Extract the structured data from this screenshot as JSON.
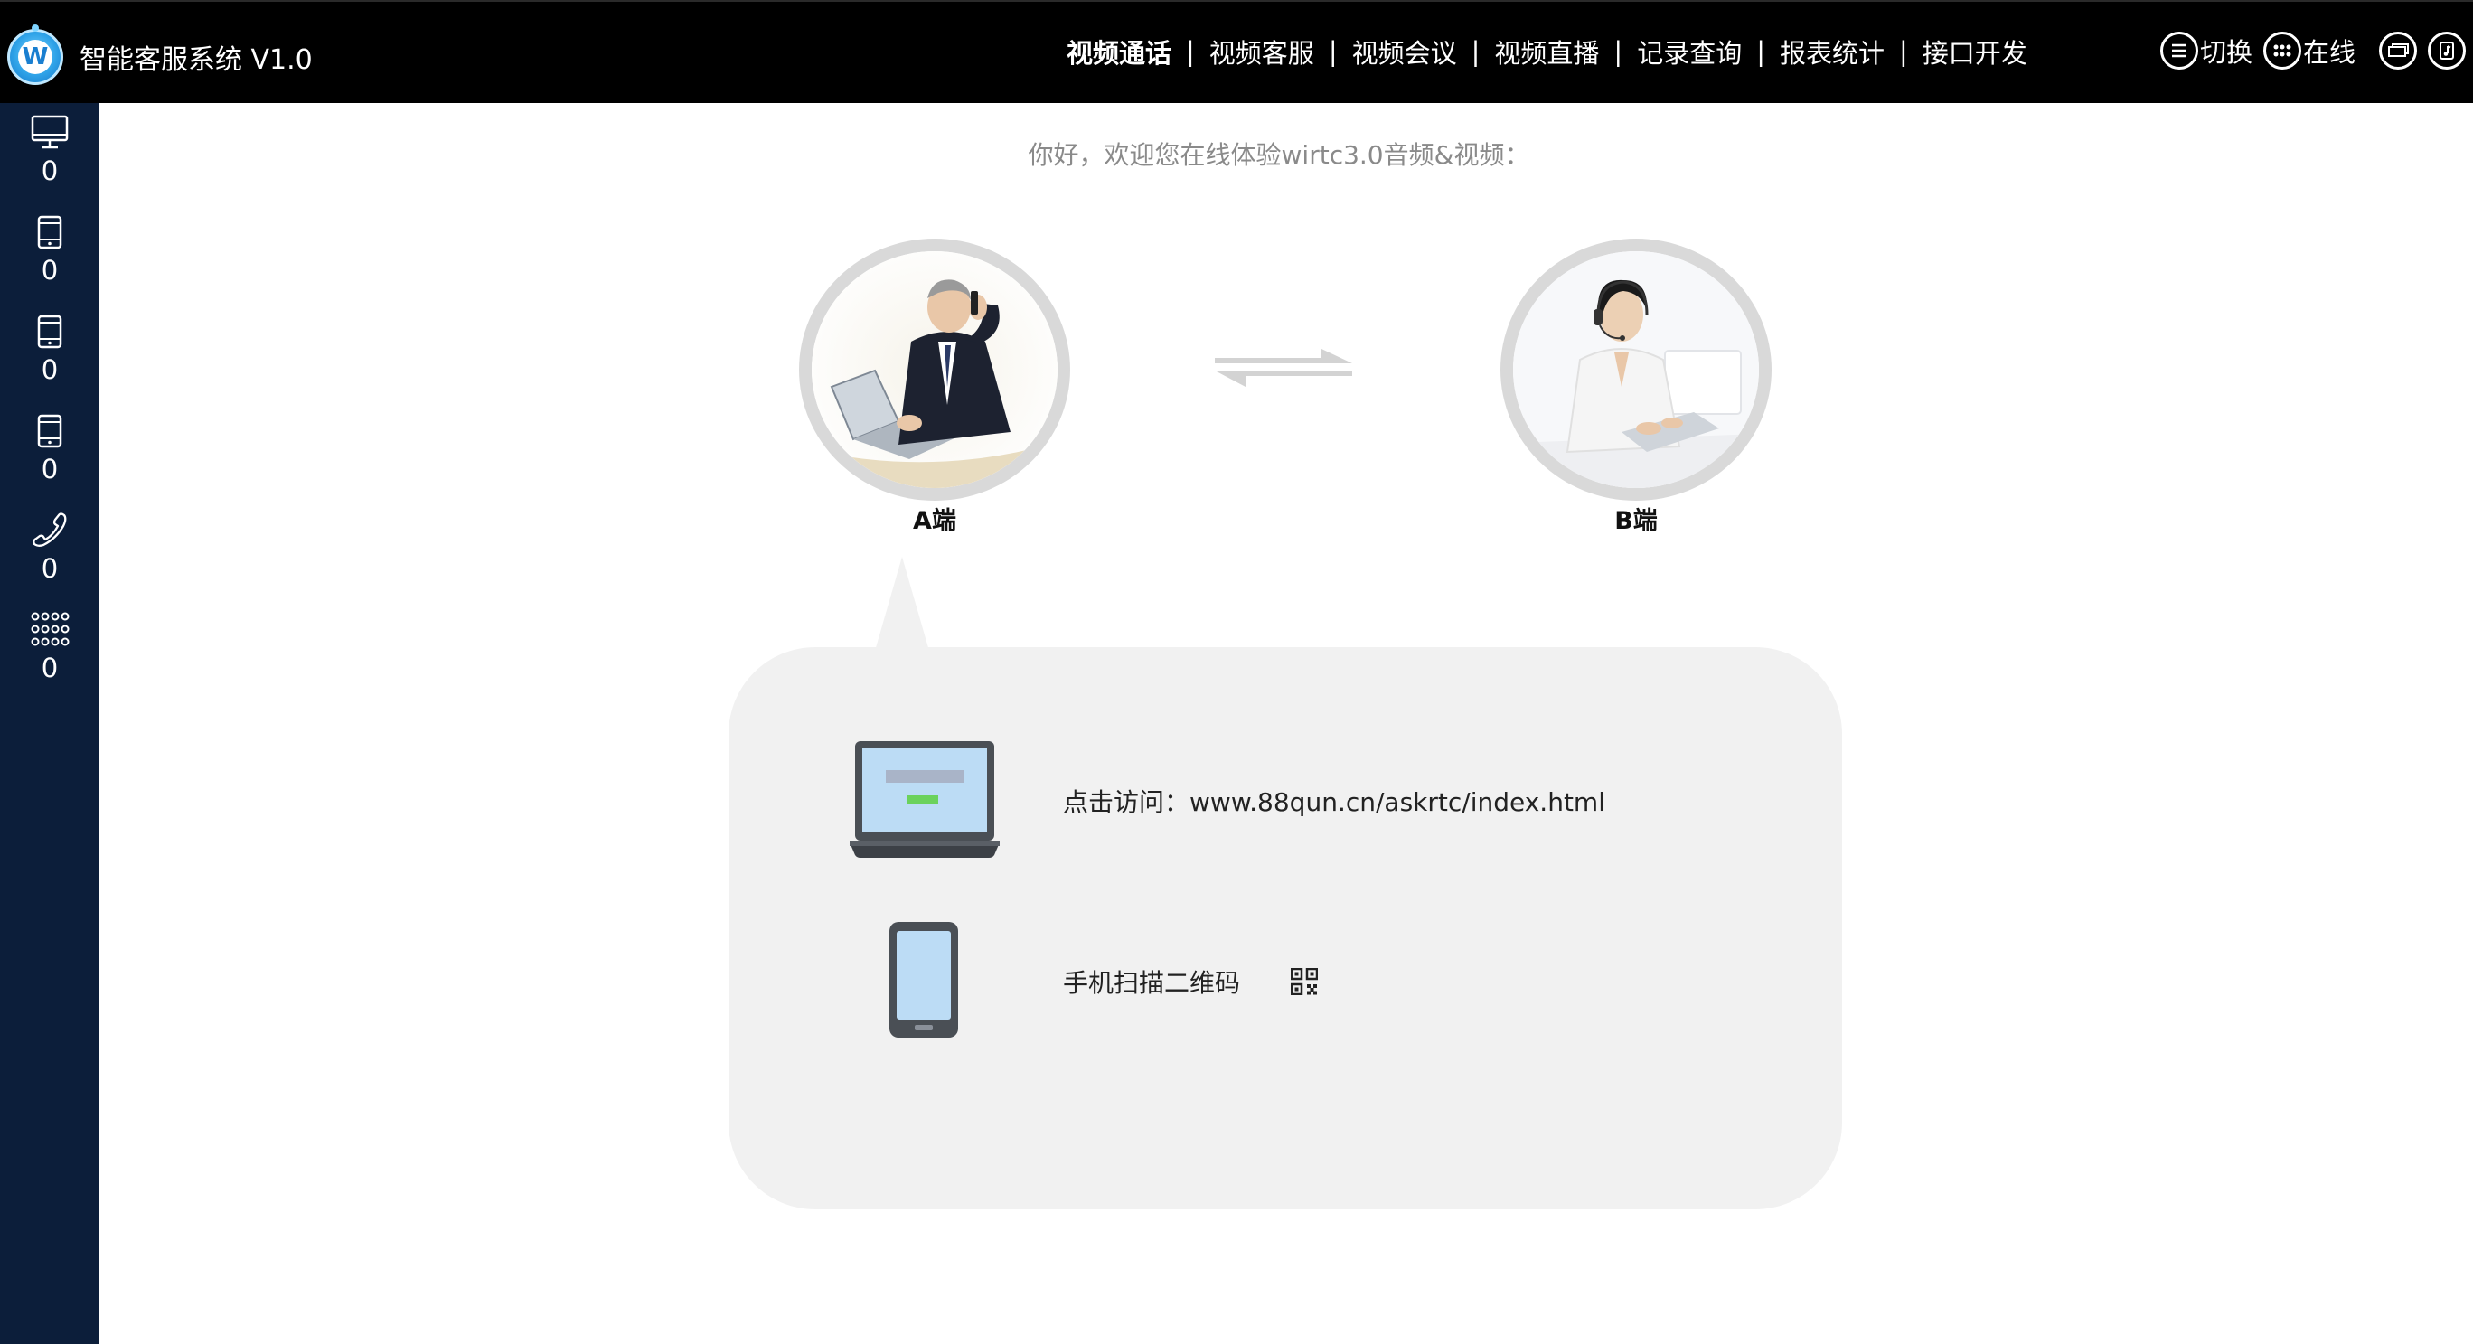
{
  "app": {
    "title": "智能客服系统 V1.0",
    "logo_letter": "W"
  },
  "topnav": {
    "items": [
      {
        "label": "视频通话",
        "active": true
      },
      {
        "label": "视频客服",
        "active": false
      },
      {
        "label": "视频会议",
        "active": false
      },
      {
        "label": "视频直播",
        "active": false
      },
      {
        "label": "记录查询",
        "active": false
      },
      {
        "label": "报表统计",
        "active": false
      },
      {
        "label": "接口开发",
        "active": false
      }
    ],
    "separator": "|"
  },
  "top_actions": {
    "switch_label": "切换",
    "online_label": "在线",
    "switch_icon": "menu-lines-icon",
    "online_icon": "dots-grid-icon",
    "window_icon": "window-icon",
    "music_icon": "music-note-icon"
  },
  "sidebar": {
    "items": [
      {
        "icon": "monitor-icon",
        "count": "0"
      },
      {
        "icon": "tablet-icon",
        "count": "0"
      },
      {
        "icon": "tablet-icon",
        "count": "0"
      },
      {
        "icon": "tablet-icon",
        "count": "0"
      },
      {
        "icon": "phone-handset-icon",
        "count": "0"
      },
      {
        "icon": "dialpad-icon",
        "count": "0"
      }
    ]
  },
  "main": {
    "welcome": "你好，欢迎您在线体验wirtc3.0音频&视频：",
    "party_a": {
      "label": "A端",
      "avatar": "businessman-phone-avatar"
    },
    "party_b": {
      "label": "B端",
      "avatar": "agent-headset-avatar"
    },
    "swap_icon": "swap-arrows-icon",
    "visit_label": "点击访问：",
    "visit_url": "www.88qun.cn/askrtc/index.html",
    "scan_label": "手机扫描二维码",
    "laptop_icon": "laptop-icon",
    "mobile_icon": "mobile-phone-icon",
    "qr_icon": "qr-code-icon"
  },
  "colors": {
    "topbar_bg": "#000000",
    "sidebar_bg": "#0c1e3a",
    "bubble_bg": "#f1f1f1",
    "ring": "#d9d9d9",
    "accent_green": "#6bd25c",
    "screen_blue": "#bcdcf5"
  }
}
